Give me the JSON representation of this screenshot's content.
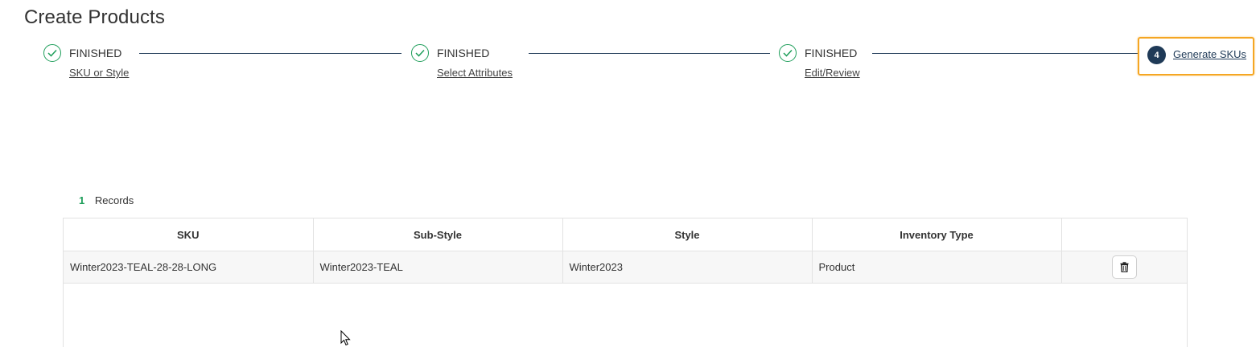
{
  "page": {
    "title": "Create Products"
  },
  "stepper": {
    "steps": [
      {
        "status": "FINISHED",
        "label": "SKU or Style",
        "icon": "check-icon"
      },
      {
        "status": "FINISHED",
        "label": "Select Attributes",
        "icon": "check-icon"
      },
      {
        "status": "FINISHED",
        "label": "Edit/Review",
        "icon": "check-icon"
      }
    ],
    "active": {
      "number": "4",
      "label": "Generate SKUs"
    }
  },
  "records": {
    "count": "1",
    "label": "Records"
  },
  "table": {
    "headers": [
      "SKU",
      "Sub-Style",
      "Style",
      "Inventory Type",
      ""
    ],
    "rows": [
      {
        "sku": "Winter2023-TEAL-28-28-LONG",
        "sub_style": "Winter2023-TEAL",
        "style": "Winter2023",
        "inventory_type": "Product",
        "action_icon": "trash-icon"
      }
    ]
  },
  "colors": {
    "finished": "#1e9e5a",
    "active_step": "#1f3a57",
    "highlight": "#f5a623"
  }
}
